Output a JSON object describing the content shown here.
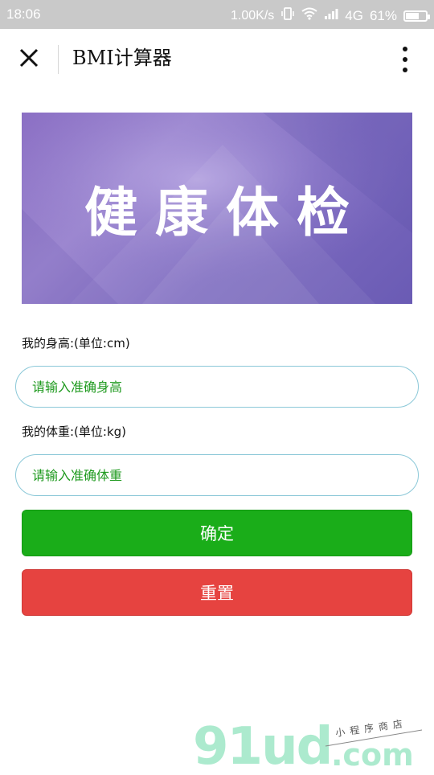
{
  "status_bar": {
    "time": "18:06",
    "speed": "1.00K/s",
    "network": "4G",
    "battery": "61%"
  },
  "nav": {
    "title": "BMI计算器"
  },
  "banner": {
    "title": "健康体检"
  },
  "form": {
    "height_label": "我的身高:(单位:cm)",
    "height_placeholder": "请输入准确身高",
    "weight_label": "我的体重:(单位:kg)",
    "weight_placeholder": "请输入准确体重"
  },
  "buttons": {
    "confirm": "确定",
    "reset": "重置"
  },
  "watermark": {
    "brand": "91ud",
    "domain": ".com",
    "tagline": "小程序商店"
  },
  "colors": {
    "confirm": "#1aad19",
    "reset": "#e64340",
    "input_border": "#8bc8d8",
    "placeholder": "#1f9a1f"
  }
}
